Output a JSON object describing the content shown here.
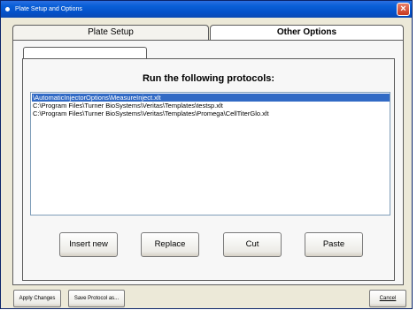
{
  "window": {
    "title": "Plate Setup and Options",
    "close_glyph": "×"
  },
  "tabs": [
    {
      "label": "Plate Setup",
      "active": false
    },
    {
      "label": "Other Options",
      "active": true
    }
  ],
  "protocols": {
    "heading": "Run the following protocols:",
    "items": [
      {
        "path": "\\AutomaticInjectorOptions\\MeasureInject.xlt",
        "selected": true
      },
      {
        "path": "C:\\Program Files\\Turner BioSystems\\Veritas\\Templates\\testsp.xlt",
        "selected": false
      },
      {
        "path": "C:\\Program Files\\Turner BioSystems\\Veritas\\Templates\\Promega\\CellTiterGlo.xlt",
        "selected": false
      }
    ]
  },
  "list_buttons": {
    "insert_new": "Insert new",
    "replace": "Replace",
    "cut": "Cut",
    "paste": "Paste"
  },
  "footer": {
    "apply_changes": "Apply Changes",
    "save_protocol_as": "Save Protocol as...",
    "cancel": "Cancel"
  },
  "colors": {
    "titlebar": "#0451c9",
    "selection": "#316ac5",
    "window_background": "#ece9d8"
  }
}
